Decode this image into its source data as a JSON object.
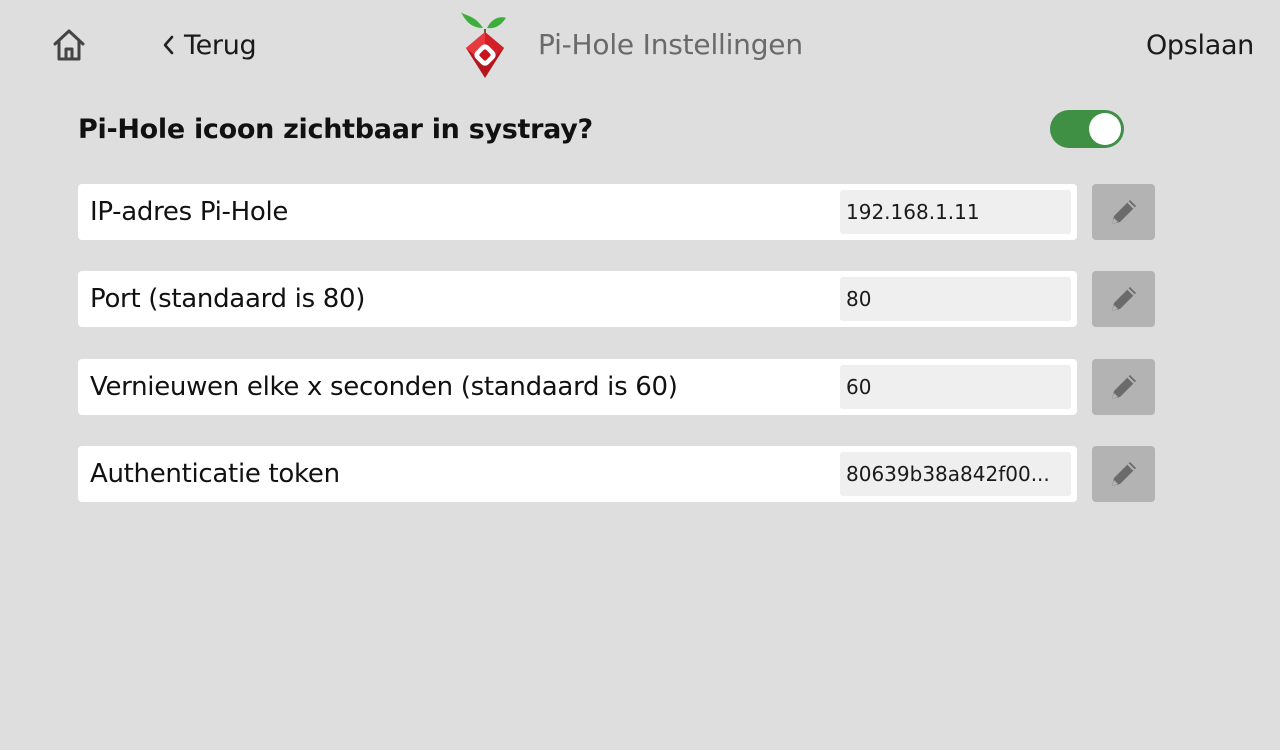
{
  "header": {
    "back_label": "Terug",
    "title": "Pi-Hole Instellingen",
    "save_label": "Opslaan",
    "icons": {
      "home": "home-icon",
      "back": "chevron-left-icon",
      "logo": "pihole-logo"
    }
  },
  "systray": {
    "question": "Pi-Hole icoon zichtbaar in systray?",
    "enabled": true,
    "accent_color": "#3f8f45"
  },
  "settings": [
    {
      "label": "IP-adres Pi-Hole",
      "value": "192.168.1.11",
      "edit_icon": "pencil-icon"
    },
    {
      "label": "Port (standaard is 80)",
      "value": "80",
      "edit_icon": "pencil-icon"
    },
    {
      "label": "Vernieuwen elke x seconden (standaard is 60)",
      "value": "60",
      "edit_icon": "pencil-icon"
    },
    {
      "label": "Authenticatie token",
      "value": "80639b38a842f00...",
      "edit_icon": "pencil-icon"
    }
  ]
}
